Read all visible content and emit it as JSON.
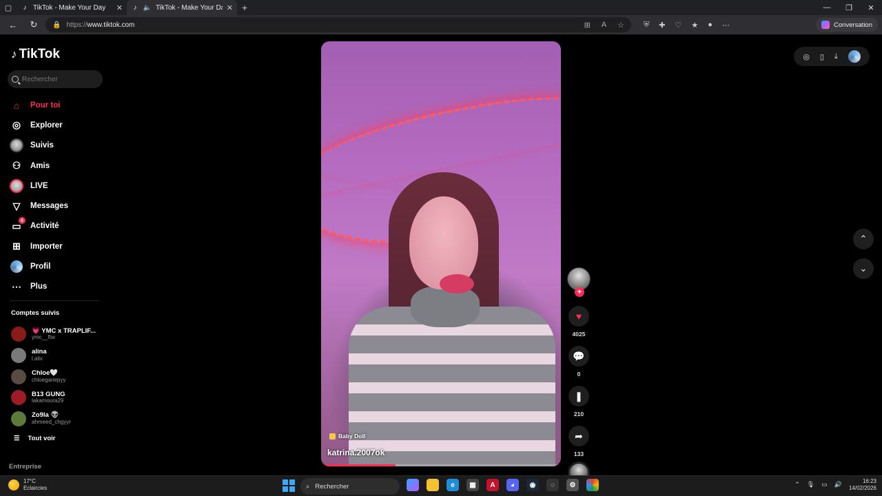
{
  "browser": {
    "tabs": [
      {
        "title": "TikTok - Make Your Day",
        "active": false
      },
      {
        "title": "TikTok - Make Your Day",
        "active": true
      }
    ],
    "url_protocol": "https://",
    "url_host": "www.tiktok.com",
    "conversation_label": "Conversation"
  },
  "sidebar": {
    "logo": "TikTok",
    "search_placeholder": "Rechercher",
    "nav": [
      {
        "label": "Pour toi",
        "icon": "home-icon",
        "active": true
      },
      {
        "label": "Explorer",
        "icon": "compass-icon"
      },
      {
        "label": "Suivis",
        "icon": "following-avatar-icon"
      },
      {
        "label": "Amis",
        "icon": "friends-icon"
      },
      {
        "label": "LIVE",
        "icon": "live-avatar-icon"
      },
      {
        "label": "Messages",
        "icon": "send-icon"
      },
      {
        "label": "Activité",
        "icon": "activity-icon",
        "badge": "8"
      },
      {
        "label": "Importer",
        "icon": "upload-plus-icon"
      },
      {
        "label": "Profil",
        "icon": "profile-avatar-icon"
      },
      {
        "label": "Plus",
        "icon": "more-icon"
      }
    ],
    "following_title": "Comptes suivis",
    "following": [
      {
        "name": "💗 YMC x TRAPLIF...",
        "handle": "ymc__ftw",
        "color": "#8b1a1a"
      },
      {
        "name": "alina",
        "handle": "l.alix",
        "color": "#7a7a7a"
      },
      {
        "name": "Chloe🤍",
        "handle": "chloegariepyy",
        "color": "#5a4a44"
      },
      {
        "name": "B13 GUNG",
        "handle": "lakamoura29",
        "color": "#9b1c24"
      },
      {
        "name": "Zo9la 👽",
        "handle": "ahmeed_chgyyr",
        "color": "#5e7a3a"
      }
    ],
    "see_all": "Tout voir",
    "footer": "Entreprise"
  },
  "video": {
    "sound": "Baby Doll",
    "author": "katrina.2007ok",
    "progress": 0.31
  },
  "actions": {
    "likes": "4025",
    "comments": "0",
    "saves": "210",
    "shares": "133"
  },
  "taskbar": {
    "temperature": "17°C",
    "weather": "Eclaircies",
    "search": "Rechercher",
    "time": "16:23",
    "date": "14/02/2026"
  },
  "colors": {
    "accent": "#fe2c55",
    "background": "#000000"
  }
}
